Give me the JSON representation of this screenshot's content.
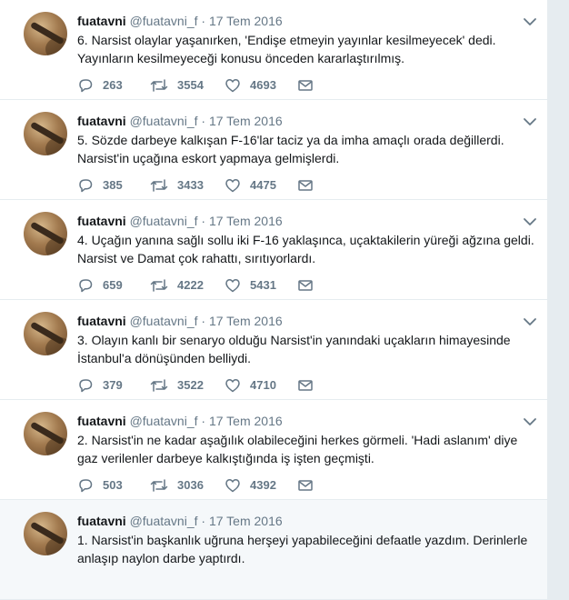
{
  "tweets": [
    {
      "name": "fuatavni",
      "handle": "@fuatavni_f",
      "separator": "·",
      "date": "17 Tem 2016",
      "text": "6. Narsist olaylar yaşanırken, 'Endişe etmeyin yayınlar kesilmeyecek' dedi. Yayınların kesilmeyeceği konusu önceden kararlaştırılmış.",
      "replies": "263",
      "retweets": "3554",
      "likes": "4693"
    },
    {
      "name": "fuatavni",
      "handle": "@fuatavni_f",
      "separator": "·",
      "date": "17 Tem 2016",
      "text": "5. Sözde darbeye kalkışan F-16'lar taciz ya da imha amaçlı orada değillerdi. Narsist'in uçağına eskort yapmaya gelmişlerdi.",
      "replies": "385",
      "retweets": "3433",
      "likes": "4475"
    },
    {
      "name": "fuatavni",
      "handle": "@fuatavni_f",
      "separator": "·",
      "date": "17 Tem 2016",
      "text": "4. Uçağın yanına sağlı sollu iki F-16 yaklaşınca, uçaktakilerin yüreği ağzına geldi. Narsist ve Damat çok rahattı, sırıtıyorlardı.",
      "replies": "659",
      "retweets": "4222",
      "likes": "5431"
    },
    {
      "name": "fuatavni",
      "handle": "@fuatavni_f",
      "separator": "·",
      "date": "17 Tem 2016",
      "text": "3. Olayın kanlı bir senaryo olduğu Narsist'in yanındaki uçakların himayesinde İstanbul'a dönüşünden belliydi.",
      "replies": "379",
      "retweets": "3522",
      "likes": "4710"
    },
    {
      "name": "fuatavni",
      "handle": "@fuatavni_f",
      "separator": "·",
      "date": "17 Tem 2016",
      "text": "2. Narsist'in ne kadar aşağılık olabileceğini herkes görmeli. 'Hadi aslanım' diye gaz verilenler darbeye kalkıştığında iş işten geçmişti.",
      "replies": "503",
      "retweets": "3036",
      "likes": "4392"
    },
    {
      "name": "fuatavni",
      "handle": "@fuatavni_f",
      "separator": "·",
      "date": "17 Tem 2016",
      "text": "1. Narsist'in başkanlık uğruna herşeyi yapabileceğini defaatle yazdım. Derinlerle anlaşıp naylon darbe yaptırdı.",
      "replies": "",
      "retweets": "",
      "likes": ""
    }
  ],
  "icons": {
    "reply": "reply-icon",
    "retweet": "retweet-icon",
    "like": "like-icon",
    "message": "direct-message-icon",
    "caret": "chevron-down-icon"
  },
  "colors": {
    "name": "#14171a",
    "meta": "#657786",
    "divider": "#e6ecf0",
    "highlight_background": "#f5f8fa"
  }
}
